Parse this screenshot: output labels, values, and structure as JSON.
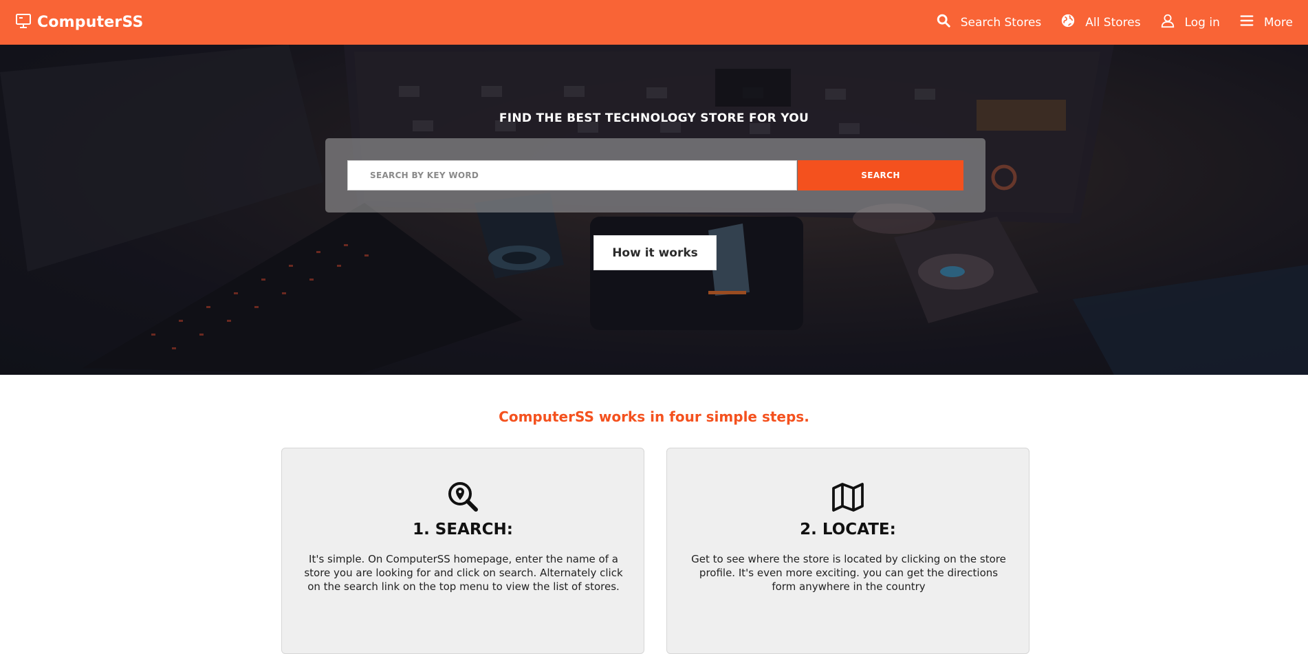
{
  "nav": {
    "brand": "ComputerSS",
    "brand_icon": "monitor-icon",
    "links": [
      {
        "label": "Search Stores",
        "icon": "search-icon"
      },
      {
        "label": "All Stores",
        "icon": "globe-icon"
      },
      {
        "label": "Log in",
        "icon": "user-icon"
      },
      {
        "label": "More",
        "icon": "menu-icon"
      }
    ]
  },
  "hero": {
    "title": "FIND THE BEST TECHNOLOGY STORE FOR YOU",
    "search_placeholder": "SEARCH BY KEY WORD",
    "search_button": "SEARCH",
    "how_button": "How it works"
  },
  "steps": {
    "heading": "ComputerSS works in four simple steps.",
    "cards": [
      {
        "icon": "search-location-icon",
        "title": "1. SEARCH:",
        "text": "It's simple. On ComputerSS homepage, enter the name of a store you are looking for and click on search. Alternately click on the search link on the top menu to view the list of stores."
      },
      {
        "icon": "map-icon",
        "title": "2. LOCATE:",
        "text": "Get to see where the store is located by clicking on the store profile. It's even more exciting. you can get the directions form anywhere in the country"
      }
    ]
  },
  "colors": {
    "navbar": "#f96436",
    "accent": "#f4511e",
    "card_bg": "#efefef"
  }
}
